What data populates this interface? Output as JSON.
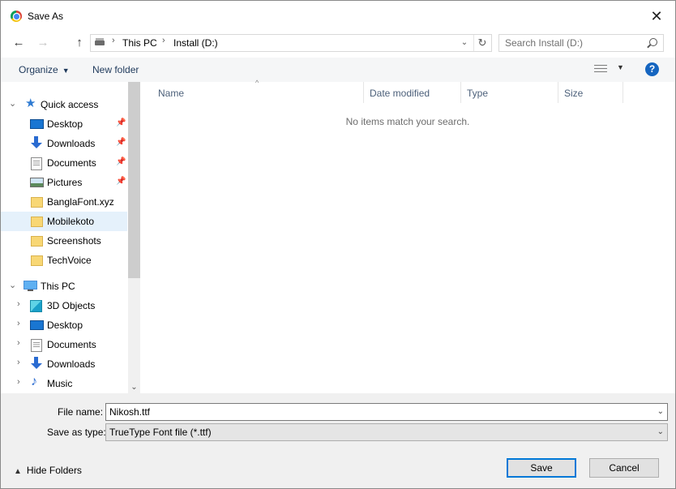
{
  "window": {
    "title": "Save As",
    "app_icon": "chrome-icon",
    "close_glyph": "✕"
  },
  "nav": {
    "back_glyph": "←",
    "forward_glyph": "→",
    "up_glyph": "↑",
    "breadcrumbs": [
      "This PC",
      "Install (D:)"
    ],
    "search_placeholder": "Search Install (D:)"
  },
  "toolbar": {
    "organize": "Organize",
    "new_folder": "New folder",
    "help_glyph": "?"
  },
  "sidebar": {
    "quick_access": "Quick access",
    "quick_items": [
      {
        "label": "Desktop",
        "icon": "desktop-icon",
        "pinned": true
      },
      {
        "label": "Downloads",
        "icon": "download-icon",
        "pinned": true
      },
      {
        "label": "Documents",
        "icon": "document-icon",
        "pinned": true
      },
      {
        "label": "Pictures",
        "icon": "pictures-icon",
        "pinned": true
      },
      {
        "label": "BanglaFont.xyz",
        "icon": "folder-icon",
        "pinned": false
      },
      {
        "label": "Mobilekoto",
        "icon": "folder-icon",
        "pinned": false,
        "selected": true
      },
      {
        "label": "Screenshots",
        "icon": "folder-icon",
        "pinned": false
      },
      {
        "label": "TechVoice",
        "icon": "folder-icon",
        "pinned": false
      }
    ],
    "this_pc": "This PC",
    "pc_items": [
      {
        "label": "3D Objects",
        "icon": "3d-objects-icon"
      },
      {
        "label": "Desktop",
        "icon": "desktop-icon"
      },
      {
        "label": "Documents",
        "icon": "document-icon"
      },
      {
        "label": "Downloads",
        "icon": "download-icon"
      },
      {
        "label": "Music",
        "icon": "music-icon"
      }
    ]
  },
  "columns": [
    "Name",
    "Date modified",
    "Type",
    "Size"
  ],
  "content": {
    "empty_message": "No items match your search."
  },
  "form": {
    "file_name_label": "File name:",
    "file_name_value": "Nikosh.ttf",
    "save_type_label": "Save as type:",
    "save_type_value": "TrueType Font file (*.ttf)"
  },
  "footer": {
    "hide_folders": "Hide Folders",
    "save": "Save",
    "cancel": "Cancel"
  },
  "colors": {
    "accent": "#0078d7",
    "selection": "#e5f1fb",
    "help": "#1565c0",
    "folder": "#f8d775"
  }
}
